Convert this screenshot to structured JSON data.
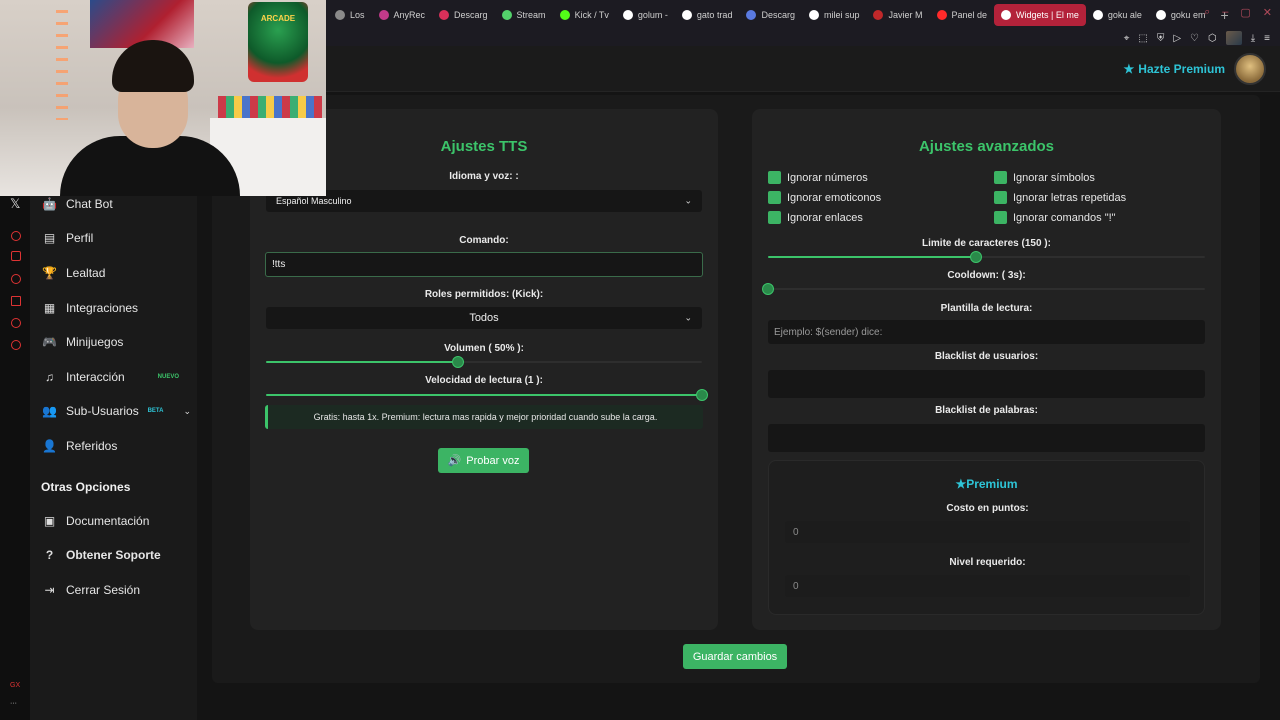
{
  "browser": {
    "tabs": [
      {
        "label": "Los",
        "color": "#8a8a8a"
      },
      {
        "label": "AnyRec",
        "color": "#c23a8a"
      },
      {
        "label": "Descarg",
        "color": "#d9305a"
      },
      {
        "label": "Stream",
        "color": "#53d26b"
      },
      {
        "label": "Kick / Tv",
        "color": "#53fc18"
      },
      {
        "label": "golum - ",
        "color": "#ffffff"
      },
      {
        "label": "gato trad",
        "color": "#ffffff"
      },
      {
        "label": "Descarg",
        "color": "#5a7ae0"
      },
      {
        "label": "milei sup",
        "color": "#ffffff"
      },
      {
        "label": "Javier M",
        "color": "#c0282a"
      },
      {
        "label": "Panel de",
        "color": "#ff2a2a"
      },
      {
        "label": "Widgets | El me",
        "color": "#ffffff"
      },
      {
        "label": "goku ale",
        "color": "#ffffff"
      },
      {
        "label": "goku em",
        "color": "#ffffff"
      }
    ],
    "active_tab_index": 11,
    "new_tab": "+"
  },
  "header": {
    "premium_link": "Hazte Premium"
  },
  "sidebar": {
    "items": [
      {
        "label": "Chat Bot",
        "icon": "robot-icon",
        "glyph": "🤖"
      },
      {
        "label": "Perfil",
        "icon": "id-card-icon",
        "glyph": "▤"
      },
      {
        "label": "Lealtad",
        "icon": "trophy-icon",
        "glyph": "🏆"
      },
      {
        "label": "Integraciones",
        "icon": "puzzle-icon",
        "glyph": "▦"
      },
      {
        "label": "Minijuegos",
        "icon": "gamepad-icon",
        "glyph": "🎮"
      },
      {
        "label": "Interacción",
        "icon": "music-icon",
        "glyph": "♫",
        "badge": "NUEVO"
      },
      {
        "label": "Sub-Usuarios",
        "icon": "users-icon",
        "glyph": "👥",
        "badge": "BETA"
      },
      {
        "label": "Referidos",
        "icon": "user-friends-icon",
        "glyph": "👤"
      }
    ],
    "section_title": "Otras Opciones",
    "other_items": [
      {
        "label": "Documentación",
        "icon": "book-icon",
        "glyph": "▣"
      },
      {
        "label": "Obtener Soporte",
        "icon": "question-icon",
        "glyph": "?"
      },
      {
        "label": "Cerrar Sesión",
        "icon": "logout-icon",
        "glyph": "⇥"
      }
    ]
  },
  "tts": {
    "title": "Ajustes TTS",
    "voice_label": "Idioma y voz: :",
    "voice_value": "Español Masculino",
    "command_label": "Comando:",
    "command_value": "!tts",
    "roles_label": "Roles permitidos: (Kick):",
    "roles_value": "Todos",
    "volume_label": "Volumen ( 50% ):",
    "volume_value": 0.44,
    "speed_label": "Velocidad de lectura (1 ):",
    "speed_value": 1.0,
    "info_text": "Gratis: hasta 1x. Premium: lectura mas rapida y mejor prioridad cuando sube la carga.",
    "test_button": "Probar voz"
  },
  "advanced": {
    "title": "Ajustes avanzados",
    "checks": [
      {
        "label": "Ignorar números",
        "checked": true
      },
      {
        "label": "Ignorar símbolos",
        "checked": true
      },
      {
        "label": "Ignorar emoticonos",
        "checked": true
      },
      {
        "label": "Ignorar letras repetidas",
        "checked": true
      },
      {
        "label": "Ignorar enlaces",
        "checked": true
      },
      {
        "label": "Ignorar comandos \"!\"",
        "checked": true
      }
    ],
    "char_limit_label": "Limite de caracteres (150 ):",
    "char_limit_value": 0.475,
    "cooldown_label": "Cooldown: ( 3s):",
    "cooldown_value": 0.0,
    "template_label": "Plantilla de lectura:",
    "template_placeholder": "Ejemplo: $(sender) dice:",
    "blacklist_users_label": "Blacklist de usuarios:",
    "blacklist_users_value": "",
    "blacklist_words_label": "Blacklist de palabras:",
    "blacklist_words_value": "",
    "premium": {
      "title": "Premium",
      "cost_label": "Costo en puntos:",
      "cost_value": "0",
      "level_label": "Nivel requerido:",
      "level_value": "0"
    }
  },
  "save_button": "Guardar cambios",
  "colors": {
    "accent": "#3cc46a",
    "premium": "#2ec4d6",
    "active_tab": "#b3223a"
  },
  "webcam": {
    "poster_text": "ARCADE"
  }
}
